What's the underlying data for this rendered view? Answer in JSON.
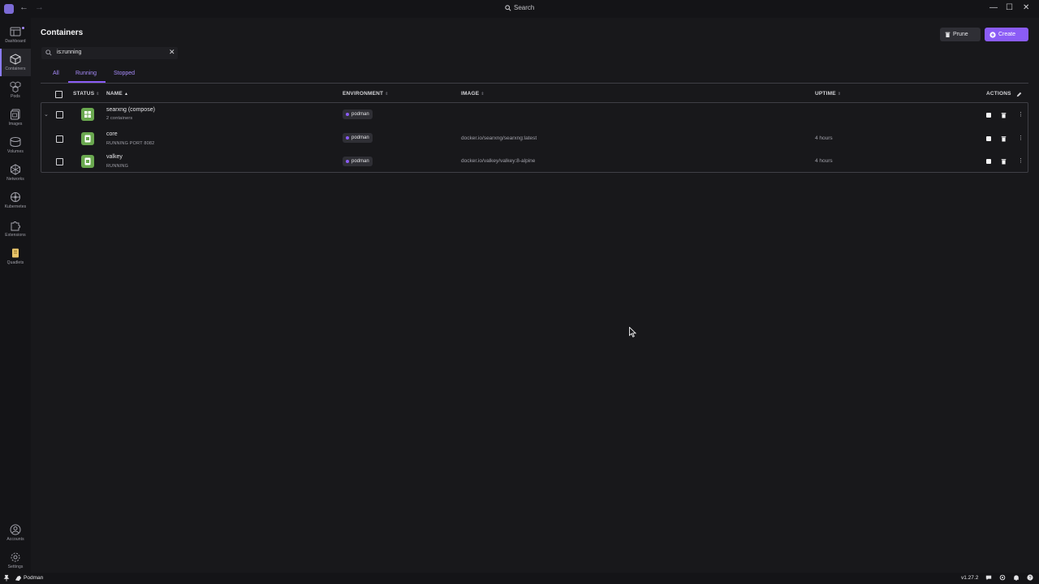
{
  "titlebar": {
    "search_label": "Search",
    "back_icon": "arrow-left-icon",
    "forward_icon": "arrow-right-icon",
    "minimize": "—",
    "maximize": "☐",
    "close": "✕"
  },
  "sidebar": {
    "items": [
      {
        "label": "Dashboard",
        "icon": "dashboard-icon"
      },
      {
        "label": "Containers",
        "icon": "cube-icon"
      },
      {
        "label": "Pods",
        "icon": "pods-icon"
      },
      {
        "label": "Images",
        "icon": "layers-icon"
      },
      {
        "label": "Volumes",
        "icon": "database-icon"
      },
      {
        "label": "Networks",
        "icon": "network-icon"
      },
      {
        "label": "Kubernetes",
        "icon": "helm-icon"
      },
      {
        "label": "Extensions",
        "icon": "puzzle-icon"
      },
      {
        "label": "Quadlets",
        "icon": "scroll-icon"
      }
    ],
    "bottom": [
      {
        "label": "Accounts",
        "icon": "user-circle-icon"
      },
      {
        "label": "Settings",
        "icon": "gear-icon"
      }
    ]
  },
  "main": {
    "title": "Containers",
    "prune_label": "Prune",
    "create_label": "Create",
    "filter_value": "is:running",
    "tabs": [
      {
        "label": "All"
      },
      {
        "label": "Running",
        "active": true
      },
      {
        "label": "Stopped"
      }
    ],
    "columns": {
      "status": "STATUS",
      "name": "NAME",
      "environment": "ENVIRONMENT",
      "image": "IMAGE",
      "uptime": "UPTIME",
      "actions": "ACTIONS"
    }
  },
  "rows": [
    {
      "name": "searxng (compose)",
      "sub": "2 containers",
      "env": "podman",
      "image": "",
      "uptime": ""
    },
    {
      "name": "core",
      "sub": "RUNNING   PORT 8082",
      "env": "podman",
      "image": "docker.io/searxng/searxng:latest",
      "uptime": "4 hours"
    },
    {
      "name": "valkey",
      "sub": "RUNNING",
      "env": "podman",
      "image": "docker.io/valkey/valkey:8-alpine",
      "uptime": "4 hours"
    }
  ],
  "statusbar": {
    "engine": "Podman",
    "version": "v1.27.2"
  },
  "colors": {
    "accent": "#8b5cf6",
    "container_icon": "#6aa84f",
    "background": "#18181b"
  }
}
